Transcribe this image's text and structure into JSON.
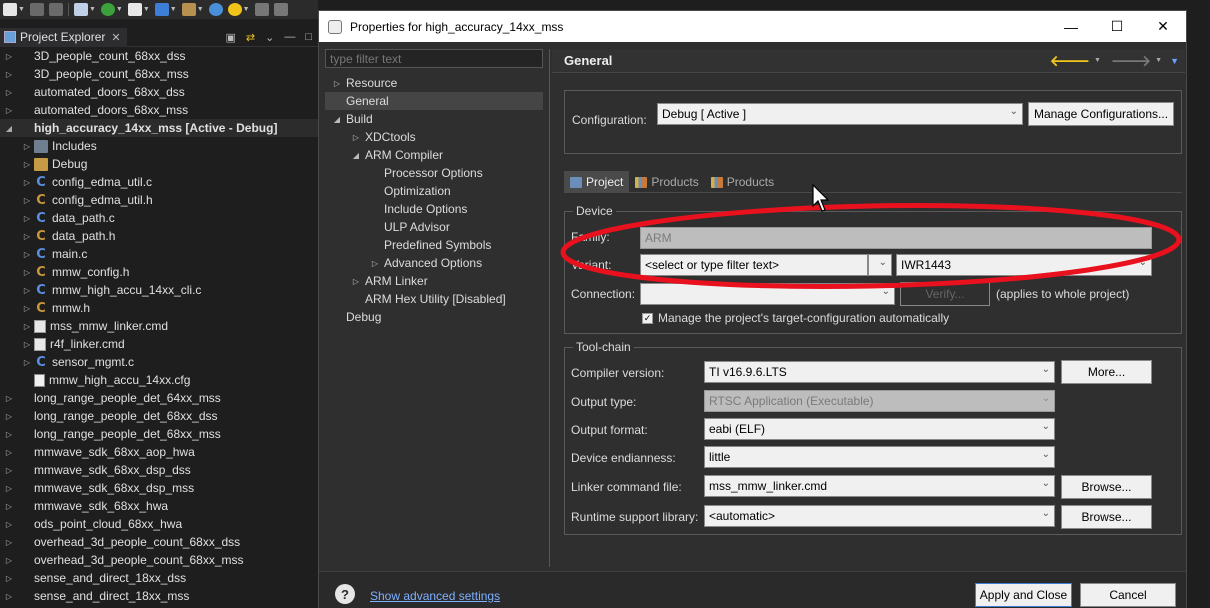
{
  "toolbar": {
    "icons": [
      "new-icon",
      "save-icon",
      "save-all-icon",
      "monitor-icon",
      "debug-icon",
      "run-icon",
      "connect-icon",
      "build-icon",
      "search-icon",
      "console-icon",
      "back-icon",
      "forward-icon"
    ]
  },
  "explorer": {
    "tab_label": "Project Explorer",
    "items": [
      {
        "label": "3D_people_count_68xx_dss",
        "type": "project",
        "level": 0
      },
      {
        "label": "3D_people_count_68xx_mss",
        "type": "project",
        "level": 0
      },
      {
        "label": "automated_doors_68xx_dss",
        "type": "project",
        "level": 0
      },
      {
        "label": "automated_doors_68xx_mss",
        "type": "project",
        "level": 0
      },
      {
        "label": "high_accuracy_14xx_mss  [Active - Debug]",
        "type": "project",
        "level": 0,
        "expanded": true,
        "selected": true
      },
      {
        "label": "Includes",
        "type": "inc",
        "level": 1
      },
      {
        "label": "Debug",
        "type": "folder",
        "level": 1
      },
      {
        "label": "config_edma_util.c",
        "type": "c",
        "level": 1
      },
      {
        "label": "config_edma_util.h",
        "type": "h",
        "level": 1
      },
      {
        "label": "data_path.c",
        "type": "c",
        "level": 1
      },
      {
        "label": "data_path.h",
        "type": "h",
        "level": 1
      },
      {
        "label": "main.c",
        "type": "c",
        "level": 1
      },
      {
        "label": "mmw_config.h",
        "type": "h",
        "level": 1
      },
      {
        "label": "mmw_high_accu_14xx_cli.c",
        "type": "c",
        "level": 1
      },
      {
        "label": "mmw.h",
        "type": "h",
        "level": 1
      },
      {
        "label": "mss_mmw_linker.cmd",
        "type": "cmd",
        "level": 1
      },
      {
        "label": "r4f_linker.cmd",
        "type": "cmd",
        "level": 1
      },
      {
        "label": "sensor_mgmt.c",
        "type": "c",
        "level": 1
      },
      {
        "label": "mmw_high_accu_14xx.cfg",
        "type": "cfg",
        "level": 1,
        "leaf": true
      },
      {
        "label": "long_range_people_det_64xx_mss",
        "type": "project",
        "level": 0
      },
      {
        "label": "long_range_people_det_68xx_dss",
        "type": "project",
        "level": 0
      },
      {
        "label": "long_range_people_det_68xx_mss",
        "type": "project",
        "level": 0
      },
      {
        "label": "mmwave_sdk_68xx_aop_hwa",
        "type": "project",
        "level": 0
      },
      {
        "label": "mmwave_sdk_68xx_dsp_dss",
        "type": "project",
        "level": 0
      },
      {
        "label": "mmwave_sdk_68xx_dsp_mss",
        "type": "project",
        "level": 0
      },
      {
        "label": "mmwave_sdk_68xx_hwa",
        "type": "project",
        "level": 0
      },
      {
        "label": "ods_point_cloud_68xx_hwa",
        "type": "project",
        "level": 0
      },
      {
        "label": "overhead_3d_people_count_68xx_dss",
        "type": "project",
        "level": 0
      },
      {
        "label": "overhead_3d_people_count_68xx_mss",
        "type": "project",
        "level": 0
      },
      {
        "label": "sense_and_direct_18xx_dss",
        "type": "project",
        "level": 0
      },
      {
        "label": "sense_and_direct_18xx_mss",
        "type": "project",
        "level": 0
      }
    ]
  },
  "dialog": {
    "title": "Properties for high_accuracy_14xx_mss",
    "filter_placeholder": "type filter text",
    "nav": [
      {
        "label": "Resource",
        "level": 0,
        "caret": "▷"
      },
      {
        "label": "General",
        "level": 0,
        "caret": "",
        "selected": true
      },
      {
        "label": "Build",
        "level": 0,
        "caret": "◢"
      },
      {
        "label": "XDCtools",
        "level": 1,
        "caret": "▷"
      },
      {
        "label": "ARM Compiler",
        "level": 1,
        "caret": "◢"
      },
      {
        "label": "Processor Options",
        "level": 2,
        "caret": ""
      },
      {
        "label": "Optimization",
        "level": 2,
        "caret": ""
      },
      {
        "label": "Include Options",
        "level": 2,
        "caret": ""
      },
      {
        "label": "ULP Advisor",
        "level": 2,
        "caret": ""
      },
      {
        "label": "Predefined Symbols",
        "level": 2,
        "caret": ""
      },
      {
        "label": "Advanced Options",
        "level": 2,
        "caret": "▷"
      },
      {
        "label": "ARM Linker",
        "level": 1,
        "caret": "▷"
      },
      {
        "label": "ARM Hex Utility  [Disabled]",
        "level": 1,
        "caret": ""
      },
      {
        "label": "Debug",
        "level": 0,
        "caret": ""
      }
    ],
    "page_title": "General",
    "configuration": {
      "label": "Configuration:",
      "value": "Debug  [ Active ]",
      "manage_label": "Manage Configurations..."
    },
    "tabs": [
      {
        "label": "Project",
        "active": true
      },
      {
        "label": "Products",
        "active": false
      },
      {
        "label": "Products",
        "active": false
      }
    ],
    "device": {
      "group_title": "Device",
      "family_label": "Family:",
      "family_value": "ARM",
      "variant_label": "Variant:",
      "variant_filter": "<select or type filter text>",
      "variant_value": "IWR1443",
      "connection_label": "Connection:",
      "connection_value": "",
      "verify_label": "Verify...",
      "applies_note": "(applies to whole project)",
      "manage_target_label": "Manage the project's target-configuration automatically"
    },
    "toolchain": {
      "group_title": "Tool-chain",
      "compiler_label": "Compiler version:",
      "compiler_value": "TI v16.9.6.LTS",
      "more_label": "More...",
      "output_type_label": "Output type:",
      "output_type_value": "RTSC Application (Executable)",
      "output_format_label": "Output format:",
      "output_format_value": "eabi (ELF)",
      "endianness_label": "Device endianness:",
      "endianness_value": "little",
      "linker_label": "Linker command file:",
      "linker_value": "mss_mmw_linker.cmd",
      "browse1_label": "Browse...",
      "runtime_label": "Runtime support library:",
      "runtime_value": "<automatic>",
      "browse2_label": "Browse..."
    },
    "footer": {
      "advanced_link": "Show advanced settings",
      "apply_close_label": "Apply and Close",
      "cancel_label": "Cancel"
    }
  },
  "colors": {
    "annotation_red": "#e8111d",
    "link_blue": "#7fb0ff",
    "accent_yellow": "#f0c419"
  }
}
